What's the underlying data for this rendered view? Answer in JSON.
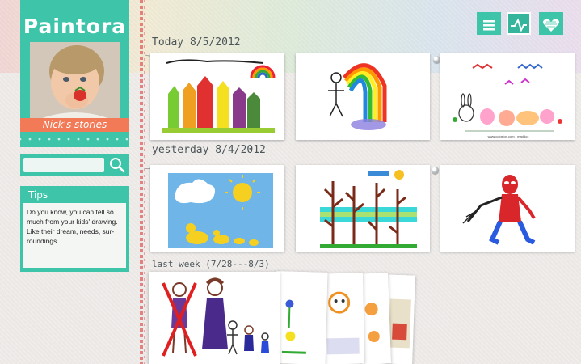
{
  "app": {
    "logo": "Paintora",
    "profile_name": "Nick's stories"
  },
  "search": {
    "placeholder": "",
    "icon": "search-icon"
  },
  "tips": {
    "title": "Tips",
    "body": "Do you know, you can tell so much from your kids' drawing. Like their dream, needs, sur-roundings."
  },
  "toolbar": {
    "views": [
      {
        "icon": "list-icon",
        "active": false
      },
      {
        "icon": "timeline-icon",
        "active": true
      },
      {
        "icon": "heart-icon",
        "active": false
      }
    ]
  },
  "sections": [
    {
      "label": "Today 8/5/2012"
    },
    {
      "label": "yesterday  8/4/2012"
    },
    {
      "label": "last week (7/28---8/3)"
    }
  ],
  "drawings": {
    "d1": {
      "icon": "houses-rainbow-drawing"
    },
    "d2": {
      "icon": "stick-figure-rainbow-drawing"
    },
    "d3": {
      "icon": "bunnies-flowers-drawing",
      "caption": "www.coloslon.com - maddox"
    },
    "d4": {
      "icon": "ducks-sun-drawing"
    },
    "d5": {
      "icon": "trees-river-drawing"
    },
    "d6": {
      "icon": "spiderman-drawing"
    },
    "d7": {
      "icon": "family-drawing"
    }
  },
  "colors": {
    "accent": "#3ec4a9",
    "ribbon": "#f27a57",
    "stitch": "#e05e5e"
  }
}
